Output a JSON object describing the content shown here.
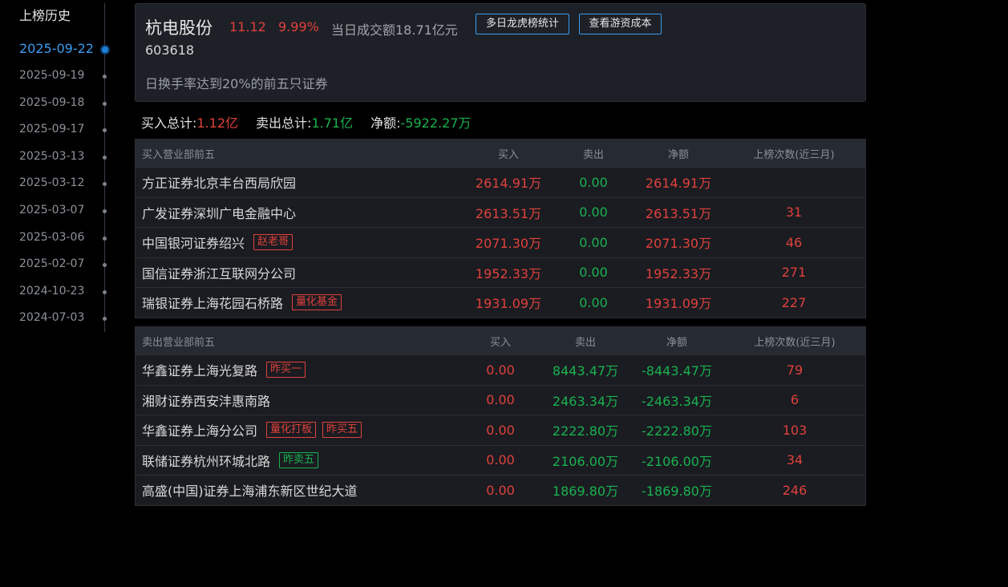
{
  "sidebar": {
    "title": "上榜历史",
    "dates": [
      "2025-09-22",
      "2025-09-19",
      "2025-09-18",
      "2025-09-17",
      "2025-03-13",
      "2025-03-12",
      "2025-03-07",
      "2025-03-06",
      "2025-02-07",
      "2024-10-23",
      "2024-07-03"
    ],
    "active_index": 0
  },
  "stock": {
    "name": "杭电股份",
    "price": "11.12",
    "change": "9.99%",
    "turnover": "当日成交额18.71亿元",
    "code": "603618",
    "reason": "日换手率达到20%的前五只证券",
    "btn_lhb": "多日龙虎榜统计",
    "btn_cost": "查看游资成本"
  },
  "totals": {
    "buy_label": "买入总计:",
    "buy_value": "1.12亿",
    "sell_label": "卖出总计:",
    "sell_value": "1.71亿",
    "net_label": "净额:",
    "net_value": "-5922.27万"
  },
  "buy_table": {
    "headers": [
      "买入营业部前五",
      "买入",
      "卖出",
      "净额",
      "上榜次数(近三月)"
    ],
    "rows": [
      {
        "name": "方正证券北京丰台西局欣园",
        "tags": [],
        "buy": "2614.91万",
        "sell": "0.00",
        "net": "2614.91万",
        "count": ""
      },
      {
        "name": "广发证券深圳广电金融中心",
        "tags": [],
        "buy": "2613.51万",
        "sell": "0.00",
        "net": "2613.51万",
        "count": "31"
      },
      {
        "name": "中国银河证券绍兴",
        "tags": [
          {
            "text": "赵老哥",
            "color": "red"
          }
        ],
        "buy": "2071.30万",
        "sell": "0.00",
        "net": "2071.30万",
        "count": "46"
      },
      {
        "name": "国信证券浙江互联网分公司",
        "tags": [],
        "buy": "1952.33万",
        "sell": "0.00",
        "net": "1952.33万",
        "count": "271"
      },
      {
        "name": "瑞银证券上海花园石桥路",
        "tags": [
          {
            "text": "量化基金",
            "color": "red"
          }
        ],
        "buy": "1931.09万",
        "sell": "0.00",
        "net": "1931.09万",
        "count": "227"
      }
    ]
  },
  "sell_table": {
    "headers": [
      "卖出营业部前五",
      "买入",
      "卖出",
      "净额",
      "上榜次数(近三月)"
    ],
    "rows": [
      {
        "name": "华鑫证券上海光复路",
        "tags": [
          {
            "text": "昨买一",
            "color": "red"
          }
        ],
        "buy": "0.00",
        "sell": "8443.47万",
        "net": "-8443.47万",
        "count": "79"
      },
      {
        "name": "湘财证券西安沣惠南路",
        "tags": [],
        "buy": "0.00",
        "sell": "2463.34万",
        "net": "-2463.34万",
        "count": "6"
      },
      {
        "name": "华鑫证券上海分公司",
        "tags": [
          {
            "text": "量化打板",
            "color": "red"
          },
          {
            "text": "昨买五",
            "color": "red"
          }
        ],
        "buy": "0.00",
        "sell": "2222.80万",
        "net": "-2222.80万",
        "count": "103"
      },
      {
        "name": "联储证券杭州环城北路",
        "tags": [
          {
            "text": "昨卖五",
            "color": "green"
          }
        ],
        "buy": "0.00",
        "sell": "2106.00万",
        "net": "-2106.00万",
        "count": "34"
      },
      {
        "name": "高盛(中国)证券上海浦东新区世纪大道",
        "tags": [],
        "buy": "0.00",
        "sell": "1869.80万",
        "net": "-1869.80万",
        "count": "246"
      }
    ]
  },
  "colors": {
    "up": "#e0413b",
    "down": "#19b24f",
    "accent": "#3a9cf0"
  }
}
